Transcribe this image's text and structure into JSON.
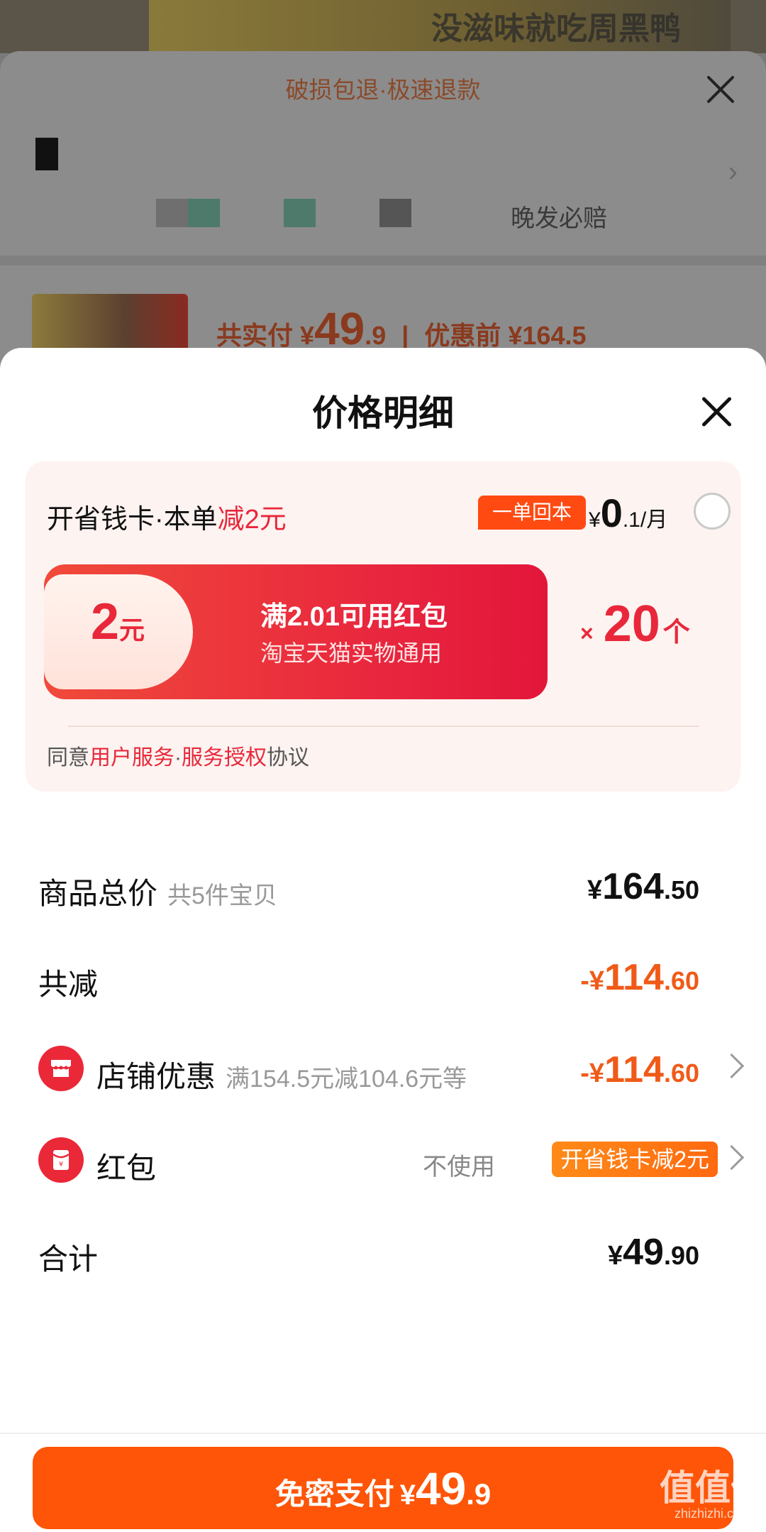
{
  "background": {
    "poster_text": "没滋味就吃周黑鸭",
    "banner": "破损包退·极速退款",
    "address_text": "晚发必赔",
    "total_paid_label": "共实付",
    "total_paid_currency": "¥",
    "total_paid_int": "49",
    "total_paid_dec": ".9",
    "before_discount": "优惠前 ¥164.5"
  },
  "modal": {
    "title": "价格明细"
  },
  "savings_card": {
    "head_prefix": "开省钱卡·本单",
    "head_highlight": "减2元",
    "tag": "一单回本",
    "price_currency": "¥",
    "price_int": "0",
    "price_rest": ".1/月",
    "coupon_amount": "2",
    "coupon_unit": "元",
    "coupon_title": "满2.01可用红包",
    "coupon_desc": "淘宝天猫实物通用",
    "mult_sign": "×",
    "mult_count": "20",
    "mult_unit": "个",
    "agree_prefix": "同意",
    "agree_link1": "用户服务",
    "agree_sep": "·",
    "agree_link2": "服务授权",
    "agree_suffix": "协议"
  },
  "rows": {
    "goods_total": {
      "label": "商品总价",
      "sub": "共5件宝贝",
      "cur": "¥",
      "int": "164",
      "dec": ".50"
    },
    "total_discount": {
      "label": "共减",
      "cur": "-¥",
      "int": "114",
      "dec": ".60"
    },
    "shop_discount": {
      "label": "店铺优惠",
      "sub": "满154.5元减104.6元等",
      "cur": "-¥",
      "int": "114",
      "dec": ".60"
    },
    "red_packet": {
      "label": "红包",
      "status": "不使用",
      "badge": "开省钱卡减2元"
    },
    "sum": {
      "label": "合计",
      "cur": "¥",
      "int": "49",
      "dec": ".90"
    }
  },
  "pay_button": {
    "label": "免密支付",
    "cur": "¥",
    "int": "49",
    "dec": ".9"
  },
  "watermark": {
    "line1": "值值值",
    "line2": "zhizhizhi.com"
  },
  "colors": {
    "accent_red": "#e8283a",
    "accent_orange": "#fe5508",
    "discount_orange": "#f05a18"
  }
}
